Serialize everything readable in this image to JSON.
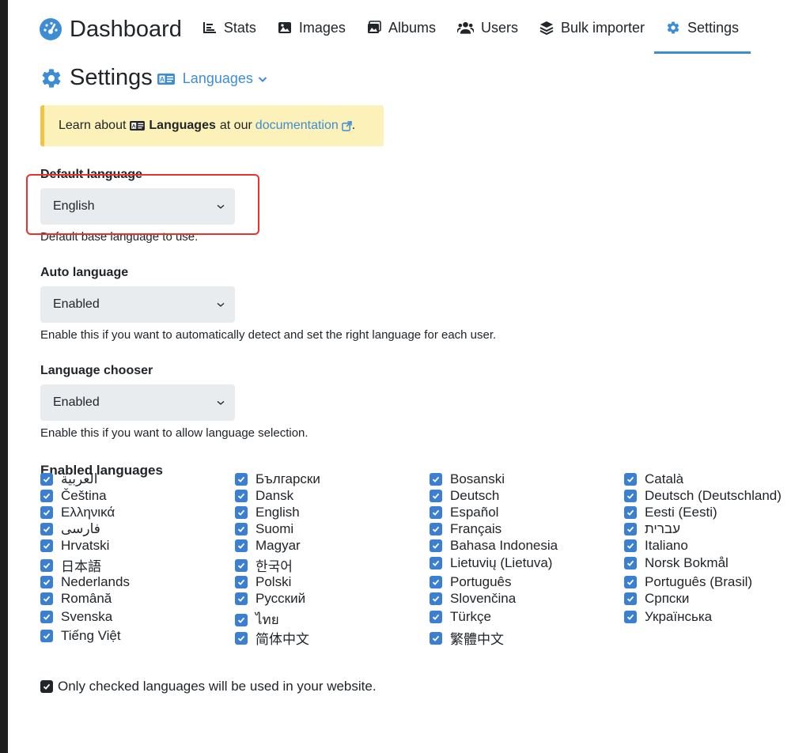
{
  "nav": {
    "brand": "Dashboard",
    "items": [
      {
        "label": "Stats",
        "icon": "bar-chart-icon"
      },
      {
        "label": "Images",
        "icon": "image-icon"
      },
      {
        "label": "Albums",
        "icon": "albums-icon"
      },
      {
        "label": "Users",
        "icon": "users-icon"
      },
      {
        "label": "Bulk importer",
        "icon": "layers-icon"
      },
      {
        "label": "Settings",
        "icon": "gear-icon",
        "active": true
      }
    ]
  },
  "page": {
    "title": "Settings",
    "section_dropdown": "Languages"
  },
  "callout": {
    "prefix": "Learn about",
    "topic": "Languages",
    "middle": "at our",
    "link": "documentation",
    "suffix": "."
  },
  "fields": {
    "default_language": {
      "label": "Default language",
      "value": "English",
      "help": "Default base language to use."
    },
    "auto_language": {
      "label": "Auto language",
      "value": "Enabled",
      "help": "Enable this if you want to automatically detect and set the right language for each user."
    },
    "language_chooser": {
      "label": "Language chooser",
      "value": "Enabled",
      "help": "Enable this if you want to allow language selection."
    }
  },
  "enabled_languages": {
    "label": "Enabled languages",
    "columns": [
      [
        {
          "name": "العربية",
          "checked": true
        },
        {
          "name": "Čeština",
          "checked": true
        },
        {
          "name": "Ελληνικά",
          "checked": true
        },
        {
          "name": "فارسی",
          "checked": true
        },
        {
          "name": "Hrvatski",
          "checked": true
        },
        {
          "name": "日本語",
          "checked": true
        },
        {
          "name": "Nederlands",
          "checked": true
        },
        {
          "name": "Română",
          "checked": true
        },
        {
          "name": "Svenska",
          "checked": true
        },
        {
          "name": "Tiếng Việt",
          "checked": true
        }
      ],
      [
        {
          "name": "Български",
          "checked": true
        },
        {
          "name": "Dansk",
          "checked": true
        },
        {
          "name": "English",
          "checked": true
        },
        {
          "name": "Suomi",
          "checked": true
        },
        {
          "name": "Magyar",
          "checked": true
        },
        {
          "name": "한국어",
          "checked": true
        },
        {
          "name": "Polski",
          "checked": true
        },
        {
          "name": "Русский",
          "checked": true
        },
        {
          "name": "ไทย",
          "checked": true
        },
        {
          "name": "简体中文",
          "checked": true
        }
      ],
      [
        {
          "name": "Bosanski",
          "checked": true
        },
        {
          "name": "Deutsch",
          "checked": true
        },
        {
          "name": "Español",
          "checked": true
        },
        {
          "name": "Français",
          "checked": true
        },
        {
          "name": "Bahasa Indonesia",
          "checked": true
        },
        {
          "name": "Lietuvių (Lietuva)",
          "checked": true
        },
        {
          "name": "Português",
          "checked": true
        },
        {
          "name": "Slovenčina",
          "checked": true
        },
        {
          "name": "Türkçe",
          "checked": true
        },
        {
          "name": "繁體中文",
          "checked": true
        }
      ],
      [
        {
          "name": "Català",
          "checked": true
        },
        {
          "name": "Deutsch (Deutschland)",
          "checked": true
        },
        {
          "name": "Eesti (Eesti)",
          "checked": true
        },
        {
          "name": "עברית",
          "checked": true
        },
        {
          "name": "Italiano",
          "checked": true
        },
        {
          "name": "Norsk Bokmål",
          "checked": true
        },
        {
          "name": "Português (Brasil)",
          "checked": true
        },
        {
          "name": "Српски",
          "checked": true
        },
        {
          "name": "Українська",
          "checked": true
        }
      ]
    ],
    "note": "Only checked languages will be used in your website."
  },
  "colors": {
    "accent": "#3d8dd4",
    "checkbox": "#3b7fd2",
    "callout_bg": "#fdf1ba",
    "callout_border": "#f0c544",
    "highlight": "#e8322b"
  }
}
